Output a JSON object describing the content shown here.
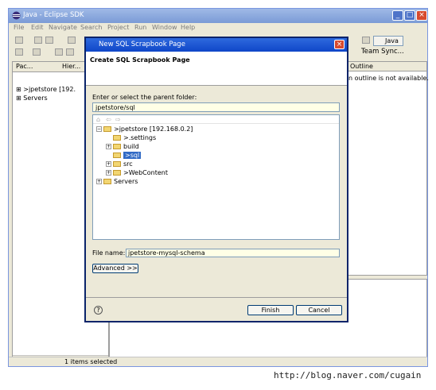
{
  "window": {
    "title": "Java - Eclipse SDK",
    "menu": [
      "File",
      "Edit",
      "Navigate",
      "Search",
      "Project",
      "Run",
      "Window",
      "Help"
    ],
    "perspective": "Java",
    "team_sync": "Team Sync..."
  },
  "left_view": {
    "tabs": [
      "Pac...",
      "Hier..."
    ],
    "tree": [
      ">jpetstore   [192.",
      "Servers"
    ]
  },
  "outline_view": {
    "tab": "Outline",
    "message": "n outline is not available."
  },
  "status": {
    "text": "1 items selected"
  },
  "dialog": {
    "title": "New SQL Scrapbook Page",
    "heading": "Create SQL Scrapbook Page",
    "folder_label": "Enter or select the parent folder:",
    "folder_value": "jpetstore/sql",
    "tree": [
      {
        "label": ">jpetstore   [192.168.0.2]",
        "level": 0,
        "expander": "−",
        "selected": false
      },
      {
        "label": ">.settings",
        "level": 1,
        "expander": "",
        "selected": false
      },
      {
        "label": "build",
        "level": 1,
        "expander": "+",
        "selected": false
      },
      {
        "label": ">sql",
        "level": 1,
        "expander": "",
        "selected": true
      },
      {
        "label": "src",
        "level": 1,
        "expander": "+",
        "selected": false
      },
      {
        "label": ">WebContent",
        "level": 1,
        "expander": "+",
        "selected": false
      },
      {
        "label": "Servers",
        "level": 0,
        "expander": "+",
        "selected": false
      }
    ],
    "file_name_label": "File name:",
    "file_name_value": "jpetstore-mysql-schema",
    "advanced_label": "Advanced >>",
    "help_label": "?",
    "finish_label": "Finish",
    "cancel_label": "Cancel"
  },
  "watermark": "http://blog.naver.com/cugain"
}
